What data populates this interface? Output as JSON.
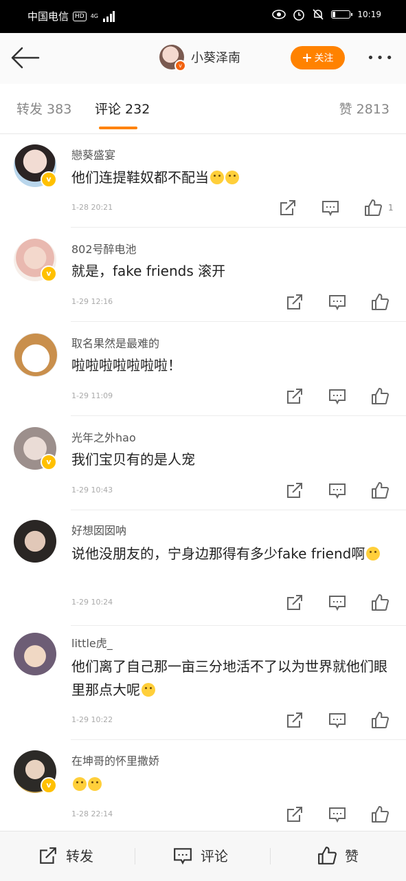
{
  "status_bar": {
    "carrier": "中国电信",
    "hd": "HD",
    "network": "4G",
    "time": "10:19"
  },
  "header": {
    "user_name": "小葵泽南",
    "follow_label": "关注",
    "follow_icon": "plus-icon",
    "more_icon": "more-dots-icon"
  },
  "tabs": [
    {
      "label": "转发 383"
    },
    {
      "label": "评论 232"
    },
    {
      "label": "赞 2813"
    }
  ],
  "colors": {
    "accent": "#ff8200",
    "verified_badge": "#ffc000"
  },
  "comments": [
    {
      "name": "戀葵盛宴",
      "text": "他们连提鞋奴都不配当",
      "time": "1-28 20:21",
      "likes": "1",
      "emoji_count": 2
    },
    {
      "name": "802号醉电池",
      "text": "就是，fake friends 滚开",
      "time": "1-29 12:16",
      "likes": "",
      "emoji_count": 0
    },
    {
      "name": "取名果然是最难的",
      "text": "啦啦啦啦啦啦啦！",
      "time": "1-29 11:09",
      "likes": "",
      "emoji_count": 0
    },
    {
      "name": "光年之外hao",
      "text": "我们宝贝有的是人宠",
      "time": "1-29 10:43",
      "likes": "",
      "emoji_count": 0
    },
    {
      "name": "好想囡囡呐",
      "text": "说他没朋友的，宁身边那得有多少fake friend啊",
      "time": "1-29 10:24",
      "likes": "",
      "emoji_count": 1
    },
    {
      "name": "little虎_",
      "text": "他们离了自己那一亩三分地活不了以为世界就他们眼里那点大呢",
      "time": "1-29 10:22",
      "likes": "",
      "emoji_count": 1
    },
    {
      "name": "在坤哥的怀里撒娇",
      "text": "",
      "time": "1-28 22:14",
      "likes": "",
      "emoji_count": 2
    }
  ],
  "bottom_bar": {
    "repost": "转发",
    "comment": "评论",
    "like": "赞"
  }
}
